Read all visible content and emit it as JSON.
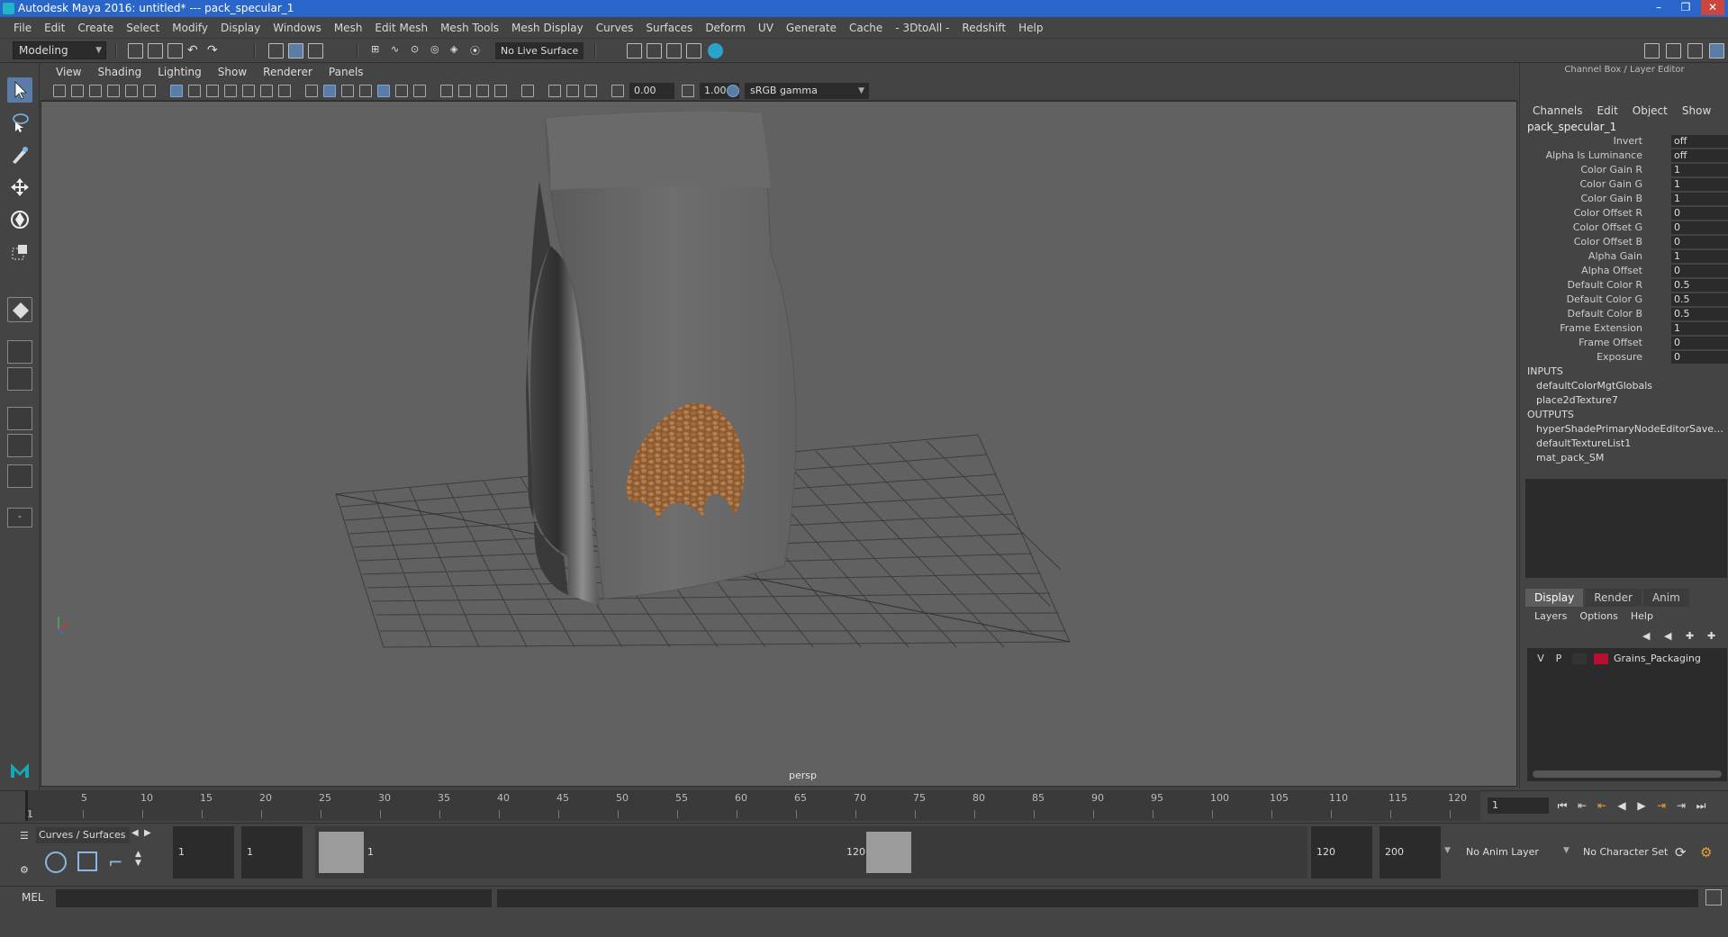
{
  "window": {
    "title": "Autodesk Maya 2016: untitled*   ---   pack_specular_1",
    "buttons": [
      "–",
      "❐",
      "✕"
    ]
  },
  "menubar": [
    "File",
    "Edit",
    "Create",
    "Select",
    "Modify",
    "Display",
    "Windows",
    "Mesh",
    "Edit Mesh",
    "Mesh Tools",
    "Mesh Display",
    "Curves",
    "Surfaces",
    "Deform",
    "UV",
    "Generate",
    "Cache",
    "- 3DtoAll -",
    "Redshift",
    "Help"
  ],
  "statusline": {
    "mode": "Modeling",
    "live_surface": "No Live Surface"
  },
  "viewport": {
    "menu": [
      "View",
      "Shading",
      "Lighting",
      "Show",
      "Renderer",
      "Panels"
    ],
    "exposure": "0.00",
    "gamma_value": "1.00",
    "color_space": "sRGB gamma",
    "camera_label": "persp"
  },
  "channel_box": {
    "title": "Channel Box / Layer Editor",
    "menu": [
      "Channels",
      "Edit",
      "Object",
      "Show"
    ],
    "node_name": "pack_specular_1",
    "attributes": [
      {
        "name": "Invert",
        "value": "off"
      },
      {
        "name": "Alpha Is Luminance",
        "value": "off"
      },
      {
        "name": "Color Gain R",
        "value": "1"
      },
      {
        "name": "Color Gain G",
        "value": "1"
      },
      {
        "name": "Color Gain B",
        "value": "1"
      },
      {
        "name": "Color Offset R",
        "value": "0"
      },
      {
        "name": "Color Offset G",
        "value": "0"
      },
      {
        "name": "Color Offset B",
        "value": "0"
      },
      {
        "name": "Alpha Gain",
        "value": "1"
      },
      {
        "name": "Alpha Offset",
        "value": "0"
      },
      {
        "name": "Default Color R",
        "value": "0.5"
      },
      {
        "name": "Default Color G",
        "value": "0.5"
      },
      {
        "name": "Default Color B",
        "value": "0.5"
      },
      {
        "name": "Frame Extension",
        "value": "1"
      },
      {
        "name": "Frame Offset",
        "value": "0"
      },
      {
        "name": "Exposure",
        "value": "0"
      }
    ],
    "inputs_label": "INPUTS",
    "inputs": [
      "defaultColorMgtGlobals",
      "place2dTexture7"
    ],
    "outputs_label": "OUTPUTS",
    "outputs": [
      "hyperShadePrimaryNodeEditorSavedT...",
      "defaultTextureList1",
      "mat_pack_SM"
    ]
  },
  "layer_editor": {
    "tabs": [
      "Display",
      "Render",
      "Anim"
    ],
    "active_tab": "Display",
    "menu": [
      "Layers",
      "Options",
      "Help"
    ],
    "layers": [
      {
        "v": "V",
        "p": "P",
        "name": "Grains_Packaging",
        "color": "#b80f30"
      }
    ]
  },
  "timeline": {
    "ticks": [
      "1",
      "5",
      "10",
      "15",
      "20",
      "25",
      "30",
      "35",
      "40",
      "45",
      "50",
      "55",
      "60",
      "65",
      "70",
      "75",
      "80",
      "85",
      "90",
      "95",
      "100",
      "105",
      "110",
      "115",
      "120"
    ],
    "current_frame": "1"
  },
  "range": {
    "shelf_label": "Curves / Surfaces",
    "start": "1",
    "playback_start": "1",
    "range_start_label": "1",
    "range_end_label": "120",
    "playback_end": "120",
    "end": "200",
    "anim_layer": "No Anim Layer",
    "character_set": "No Character Set"
  },
  "command_line": {
    "language": "MEL"
  }
}
